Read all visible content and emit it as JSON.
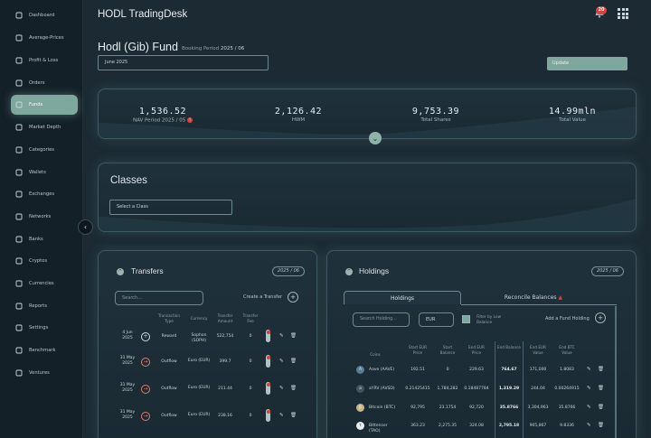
{
  "app": {
    "title": "HODL TradingDesk",
    "notifications": "20"
  },
  "sidebar": {
    "items": [
      {
        "label": "Dashboard",
        "icon": "chart-line-icon"
      },
      {
        "label": "Average-Prices",
        "icon": "bar-chart-icon"
      },
      {
        "label": "Profit & Loss",
        "icon": "dollar-circle-icon"
      },
      {
        "label": "Orders",
        "icon": "clipboard-icon"
      },
      {
        "label": "Funds",
        "icon": "folder-icon"
      },
      {
        "label": "Market Depth",
        "icon": "gauge-icon"
      },
      {
        "label": "Categories",
        "icon": "grid-icon"
      },
      {
        "label": "Wallets",
        "icon": "wallet-icon"
      },
      {
        "label": "Exchanges",
        "icon": "exchange-icon"
      },
      {
        "label": "Networks",
        "icon": "bitcoin-icon"
      },
      {
        "label": "Banks",
        "icon": "bank-icon"
      },
      {
        "label": "Cryptos",
        "icon": "crypto-icon"
      },
      {
        "label": "Currencies",
        "icon": "currency-icon"
      },
      {
        "label": "Reports",
        "icon": "report-icon"
      },
      {
        "label": "Settings",
        "icon": "gear-icon"
      },
      {
        "label": "Benchmark",
        "icon": "trend-icon"
      },
      {
        "label": "Ventures",
        "icon": "briefcase-icon"
      }
    ],
    "active": "Funds"
  },
  "fund": {
    "title": "Hodl (Gib) Fund",
    "booking_label": "Booking Period",
    "booking_value": "2025 / 06",
    "period_value": "June 2025",
    "update_label": "Update"
  },
  "stats": [
    {
      "value": "1,536.52",
      "label": "NAV Period 2025 / 05"
    },
    {
      "value": "2,126.42",
      "label": "HWM"
    },
    {
      "value": "9,753.39",
      "label": "Total Shares"
    },
    {
      "value": "14.99mln",
      "label": "Total Value"
    }
  ],
  "classes": {
    "title": "Classes",
    "placeholder": "Select a Class"
  },
  "transfers": {
    "title": "Transfers",
    "period": "2025 / 06",
    "search_placeholder": "Search...",
    "create_label": "Create a Transfer",
    "headers": [
      "Transaction Type",
      "Currency",
      "Transfer Amount",
      "Transfer Fee"
    ],
    "rows": [
      {
        "date": "4 Jun 2025",
        "type": "Reward",
        "dir": "in",
        "currency": "Sophon (SOPH)",
        "amount": "522,754",
        "fee": "0"
      },
      {
        "date": "31 May 2025",
        "type": "Outflow",
        "dir": "out",
        "currency": "Euro (EUR)",
        "amount": "399.7",
        "fee": "0"
      },
      {
        "date": "31 May 2025",
        "type": "Outflow",
        "dir": "out",
        "currency": "Euro (EUR)",
        "amount": "211.44",
        "fee": "0"
      },
      {
        "date": "31 May 2025",
        "type": "Outflow",
        "dir": "out",
        "currency": "Euro (EUR)",
        "amount": "238.16",
        "fee": "0"
      }
    ]
  },
  "holdings": {
    "title": "Holdings",
    "period": "2025 / 06",
    "tabs": [
      "Holdings",
      "Reconcile Balances"
    ],
    "search_placeholder": "Search Holding...",
    "currency": "EUR",
    "filter_label": "Filter by Low Balance",
    "add_label": "Add a Fund Holding",
    "headers": [
      "Coins",
      "Start EUR Price",
      "Start Balance",
      "End EUR Price",
      "End Balance",
      "End EUR Value",
      "End BTC Value"
    ],
    "rows": [
      {
        "coin": "Aave (AAVE)",
        "start_price": "192.51",
        "start_balance": "0",
        "end_price": "229.63",
        "end_balance": "764.67",
        "end_eur": "171,000",
        "end_btc": "1.8083",
        "color": "#5a7a8f",
        "glyph": "A"
      },
      {
        "coin": "aYRV (AVSD)",
        "start_price": "0.21425415",
        "start_balance": "1,784,282",
        "end_price": "0.18487784",
        "end_balance": "1,319.29",
        "end_eur": "244.04",
        "end_btc": "0.00264915",
        "color": "#3f5560",
        "glyph": "a"
      },
      {
        "coin": "Bitcoin (BTC)",
        "start_price": "92,795",
        "start_balance": "23.1754",
        "end_price": "92,720",
        "end_balance": "35.8766",
        "end_eur": "3,304,963",
        "end_btc": "35.8766",
        "color": "#c9b48a",
        "glyph": "₿"
      },
      {
        "coin": "Bittensor (TAO)",
        "start_price": "363.23",
        "start_balance": "2,275.35",
        "end_price": "324.08",
        "end_balance": "2,795.18",
        "end_eur": "905,867",
        "end_btc": "9.8336",
        "color": "#e6eef1",
        "glyph": "τ"
      }
    ]
  }
}
